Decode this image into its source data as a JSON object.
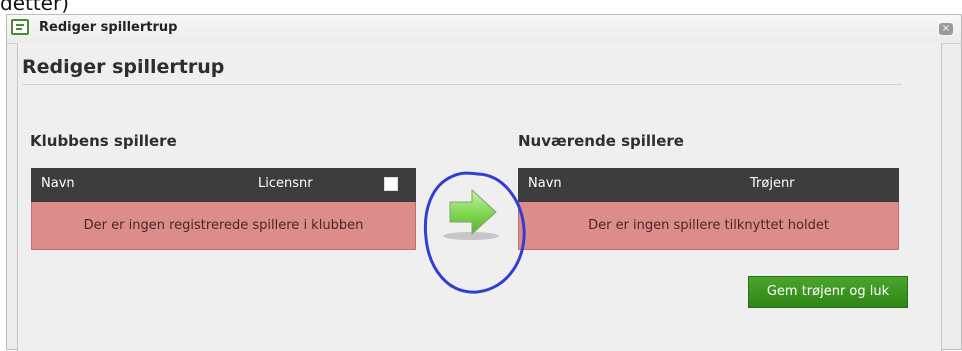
{
  "top_fragment": "detter)",
  "window": {
    "title": "Rediger spillertrup",
    "close_icon": "close-icon"
  },
  "panel": {
    "heading": "Rediger spillertrup",
    "left": {
      "section_title": "Klubbens spillere",
      "columns": [
        "Navn",
        "Licensnr"
      ],
      "empty_message": "Der er ingen registrerede spillere i klubben"
    },
    "right": {
      "section_title": "Nuværende spillere",
      "columns": [
        "Navn",
        "Trøjenr"
      ],
      "empty_message": "Der er ingen spillere tilknyttet holdet"
    },
    "transfer_icon": "arrow-right-icon",
    "save_button": "Gem trøjenr og luk"
  },
  "colors": {
    "header": "#3d3d3d",
    "empty_row": "#dc8c8a",
    "save_button": "#3b9620",
    "annotation": "#2f3fd1"
  }
}
